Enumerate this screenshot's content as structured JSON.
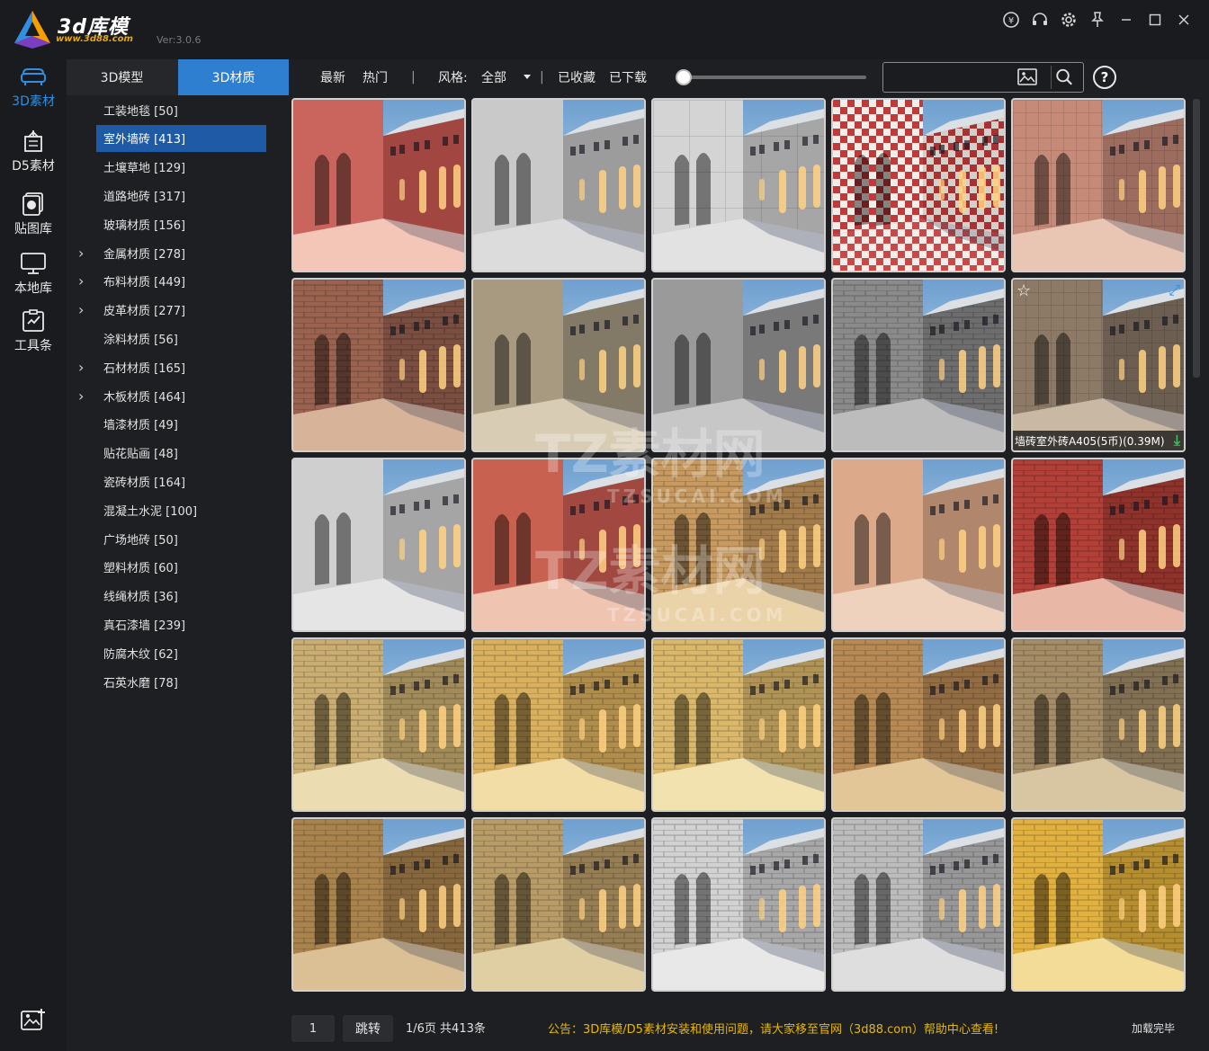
{
  "app": {
    "brand": "3d库模",
    "brand_url": "www.3d88.com",
    "version": "Ver:3.0.6"
  },
  "rail": [
    {
      "label": "3D素材",
      "icon": "sofa-icon",
      "active": true
    },
    {
      "label": "D5素材",
      "icon": "building-icon",
      "active": false
    },
    {
      "label": "贴图库",
      "icon": "texture-icon",
      "active": false
    },
    {
      "label": "本地库",
      "icon": "monitor-icon",
      "active": false
    },
    {
      "label": "工具条",
      "icon": "toolbox-icon",
      "active": false
    }
  ],
  "tabs": [
    {
      "label": "3D模型",
      "active": false
    },
    {
      "label": "3D材质",
      "active": true
    }
  ],
  "categories": [
    {
      "label": "工装地毯 [50]",
      "expandable": false
    },
    {
      "label": "室外墙砖 [413]",
      "expandable": false,
      "active": true
    },
    {
      "label": "土壤草地 [129]",
      "expandable": false
    },
    {
      "label": "道路地砖 [317]",
      "expandable": false
    },
    {
      "label": "玻璃材质 [156]",
      "expandable": false
    },
    {
      "label": "金属材质 [278]",
      "expandable": true
    },
    {
      "label": "布料材质 [449]",
      "expandable": true
    },
    {
      "label": "皮革材质 [277]",
      "expandable": true
    },
    {
      "label": "涂料材质 [56]",
      "expandable": false
    },
    {
      "label": "石材材质 [165]",
      "expandable": true
    },
    {
      "label": "木板材质 [464]",
      "expandable": true
    },
    {
      "label": "墙漆材质 [49]",
      "expandable": false
    },
    {
      "label": "贴花贴画 [48]",
      "expandable": false
    },
    {
      "label": "瓷砖材质 [164]",
      "expandable": false
    },
    {
      "label": "混凝土水泥 [100]",
      "expandable": false
    },
    {
      "label": "广场地砖 [50]",
      "expandable": false
    },
    {
      "label": "塑料材质 [60]",
      "expandable": false
    },
    {
      "label": "线绳材质 [36]",
      "expandable": false
    },
    {
      "label": "真石漆墙 [239]",
      "expandable": false
    },
    {
      "label": "防腐木纹 [62]",
      "expandable": false
    },
    {
      "label": "石英水磨 [78]",
      "expandable": false
    }
  ],
  "toolbar": {
    "latest": "最新",
    "hot": "热门",
    "sep": "|",
    "style_label": "风格:",
    "style_value": "全部",
    "favorites": "已收藏",
    "downloaded": "已下载",
    "zoom_level": 0,
    "search_placeholder": ""
  },
  "tiles": [
    {
      "wall": "#c9655c",
      "side": "#b8504a",
      "floor": "#f3c6b8",
      "pattern": "plain"
    },
    {
      "wall": "#c9c9c9",
      "side": "#b2b2b2",
      "floor": "#dcdcdc",
      "pattern": "plain"
    },
    {
      "wall": "#d4d4d4",
      "side": "#bdbdbd",
      "floor": "#e2e2e2",
      "pattern": "panel"
    },
    {
      "wall": "#c03a3a",
      "side": "#b53838",
      "floor": "#e9e0dc",
      "pattern": "checker"
    },
    {
      "wall": "#c68a78",
      "side": "#b27b6b",
      "floor": "#e9c6b4",
      "pattern": "tile"
    },
    {
      "wall": "#9a6350",
      "side": "#8b5a4a",
      "floor": "#d7b39a",
      "pattern": "brick"
    },
    {
      "wall": "#a89a80",
      "side": "#948a76",
      "floor": "#d8ccb4",
      "pattern": "plain"
    },
    {
      "wall": "#9a9a9a",
      "side": "#8a8a8a",
      "floor": "#c7c7c7",
      "pattern": "plain"
    },
    {
      "wall": "#8a8a8a",
      "side": "#7d7d7d",
      "floor": "#bcbcbc",
      "pattern": "stone"
    },
    {
      "wall": "#8c7a66",
      "side": "#7b6c5c",
      "floor": "#c9b9a4",
      "pattern": "tile",
      "star": true,
      "caption": "墙砖室外砖A405(5币)(0.39M)"
    },
    {
      "wall": "#cfcfcf",
      "side": "#bcbcbc",
      "floor": "#e5e5e5",
      "pattern": "plain"
    },
    {
      "wall": "#c8614f",
      "side": "#b8524a",
      "floor": "#efc4b0",
      "pattern": "plain"
    },
    {
      "wall": "#c69a60",
      "side": "#b98c57",
      "floor": "#ead3a8",
      "pattern": "brick"
    },
    {
      "wall": "#dcaa8a",
      "side": "#c99a7d",
      "floor": "#efd2bd",
      "pattern": "plain"
    },
    {
      "wall": "#b04038",
      "side": "#a23a33",
      "floor": "#e8b7a5",
      "pattern": "brick"
    },
    {
      "wall": "#c9ad72",
      "side": "#b89f68",
      "floor": "#ecdcb2",
      "pattern": "brick"
    },
    {
      "wall": "#d8b060",
      "side": "#c7a158",
      "floor": "#f1dda5",
      "pattern": "brick"
    },
    {
      "wall": "#d9b86c",
      "side": "#c9a964",
      "floor": "#f2e2b0",
      "pattern": "brick"
    },
    {
      "wall": "#b78a55",
      "side": "#a77d4d",
      "floor": "#e2c698",
      "pattern": "brick"
    },
    {
      "wall": "#a48c66",
      "side": "#958060",
      "floor": "#d8c6a2",
      "pattern": "brick"
    },
    {
      "wall": "#a9834e",
      "side": "#9a7747",
      "floor": "#dcc095",
      "pattern": "brick"
    },
    {
      "wall": "#b89c68",
      "side": "#aa8f60",
      "floor": "#e1cfa4",
      "pattern": "brick"
    },
    {
      "wall": "#d2d2d2",
      "side": "#c0c0c0",
      "floor": "#e8e8e8",
      "pattern": "brick"
    },
    {
      "wall": "#bcbcbc",
      "side": "#acacac",
      "floor": "#dedede",
      "pattern": "brick"
    },
    {
      "wall": "#e0b040",
      "side": "#d0a23a",
      "floor": "#f2dc98",
      "pattern": "brick"
    }
  ],
  "watermark": {
    "line1": "TZ素材网",
    "line2": "TZSUCAI.COM"
  },
  "footer": {
    "page_input": "1",
    "jump": "跳转",
    "page_info": "1/6页 共413条",
    "notice": "公告：3D库模/D5素材安装和使用问题，请大家移至官网（3d88.com）帮助中心查看!",
    "status": "加载完毕"
  }
}
